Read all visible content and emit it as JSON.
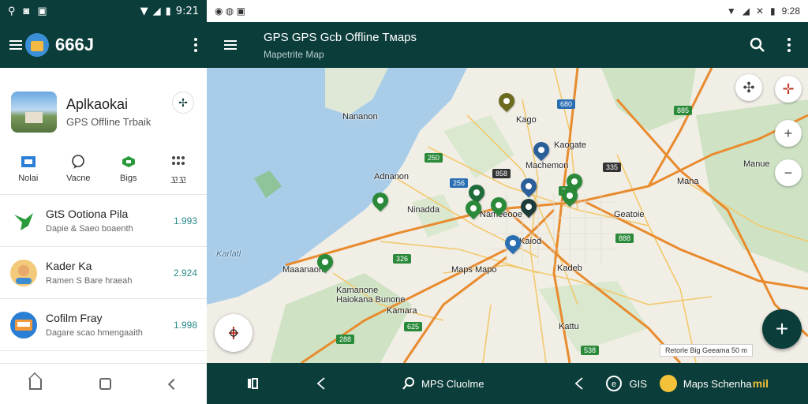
{
  "left_panel": {
    "status": {
      "time": "9:21"
    },
    "appbar": {
      "title": "666J"
    },
    "hero": {
      "app_name": "Aplkaokai",
      "subtitle": "GPS Offline Trbaik"
    },
    "quick_actions": [
      {
        "label": "Nolai",
        "icon": "map-icon"
      },
      {
        "label": "Vacne",
        "icon": "chat-icon"
      },
      {
        "label": "Bigs",
        "icon": "gift-icon"
      },
      {
        "label": "꼬꼬",
        "icon": "grid-icon"
      }
    ],
    "list": [
      {
        "name": "GtS Ootiona Pila",
        "sub": "Dapie & Saeo boaenth",
        "value": "1.993"
      },
      {
        "name": "Kader Ka",
        "sub": "Ramen S Bare hraeah",
        "value": "2.924"
      },
      {
        "name": "Cofilm Fray",
        "sub": "Dagare scao hmengaaith",
        "value": "1.998"
      }
    ]
  },
  "right_panel": {
    "status": {
      "time": "9:28"
    },
    "topbar": {
      "title": "GPS GPS Gcb Offline Tмaps",
      "subtitle": "Mapetrite Map"
    },
    "map_labels": [
      {
        "text": "Nananon"
      },
      {
        "text": "Kago"
      },
      {
        "text": "Kaogate"
      },
      {
        "text": "Machemon"
      },
      {
        "text": "Adnanon"
      },
      {
        "text": "Ninadda"
      },
      {
        "text": "Nameeooe"
      },
      {
        "text": "Kaiod"
      },
      {
        "text": "Mana"
      },
      {
        "text": "Geatoie"
      },
      {
        "text": "Manue"
      },
      {
        "text": "Kadeb"
      },
      {
        "text": "Maaanaon"
      },
      {
        "text": "Maps Mapo"
      },
      {
        "text": "Kamanone"
      },
      {
        "text": "Haiokana Bunone"
      },
      {
        "text": "Kamara"
      },
      {
        "text": "Kattu"
      },
      {
        "text": "Karlatl"
      }
    ],
    "road_badges": [
      {
        "text": "680"
      },
      {
        "text": "250"
      },
      {
        "text": "256"
      },
      {
        "text": "326"
      },
      {
        "text": "335"
      },
      {
        "text": "268"
      },
      {
        "text": "885"
      },
      {
        "text": "888"
      },
      {
        "text": "625"
      },
      {
        "text": "288"
      },
      {
        "text": "538"
      },
      {
        "text": "858"
      }
    ],
    "scale_text": "Retorle Big Geeama   50 m",
    "bottombar": {
      "search_label": "MPS Cluolme",
      "gps_label": "GIS",
      "maps_label": "Maps Schenha",
      "brand_label": "mil"
    },
    "colors": {
      "primary": "#0b3d3a",
      "water": "#a9cde9",
      "park": "#cfe3c4",
      "road": "#e88b2e"
    }
  }
}
